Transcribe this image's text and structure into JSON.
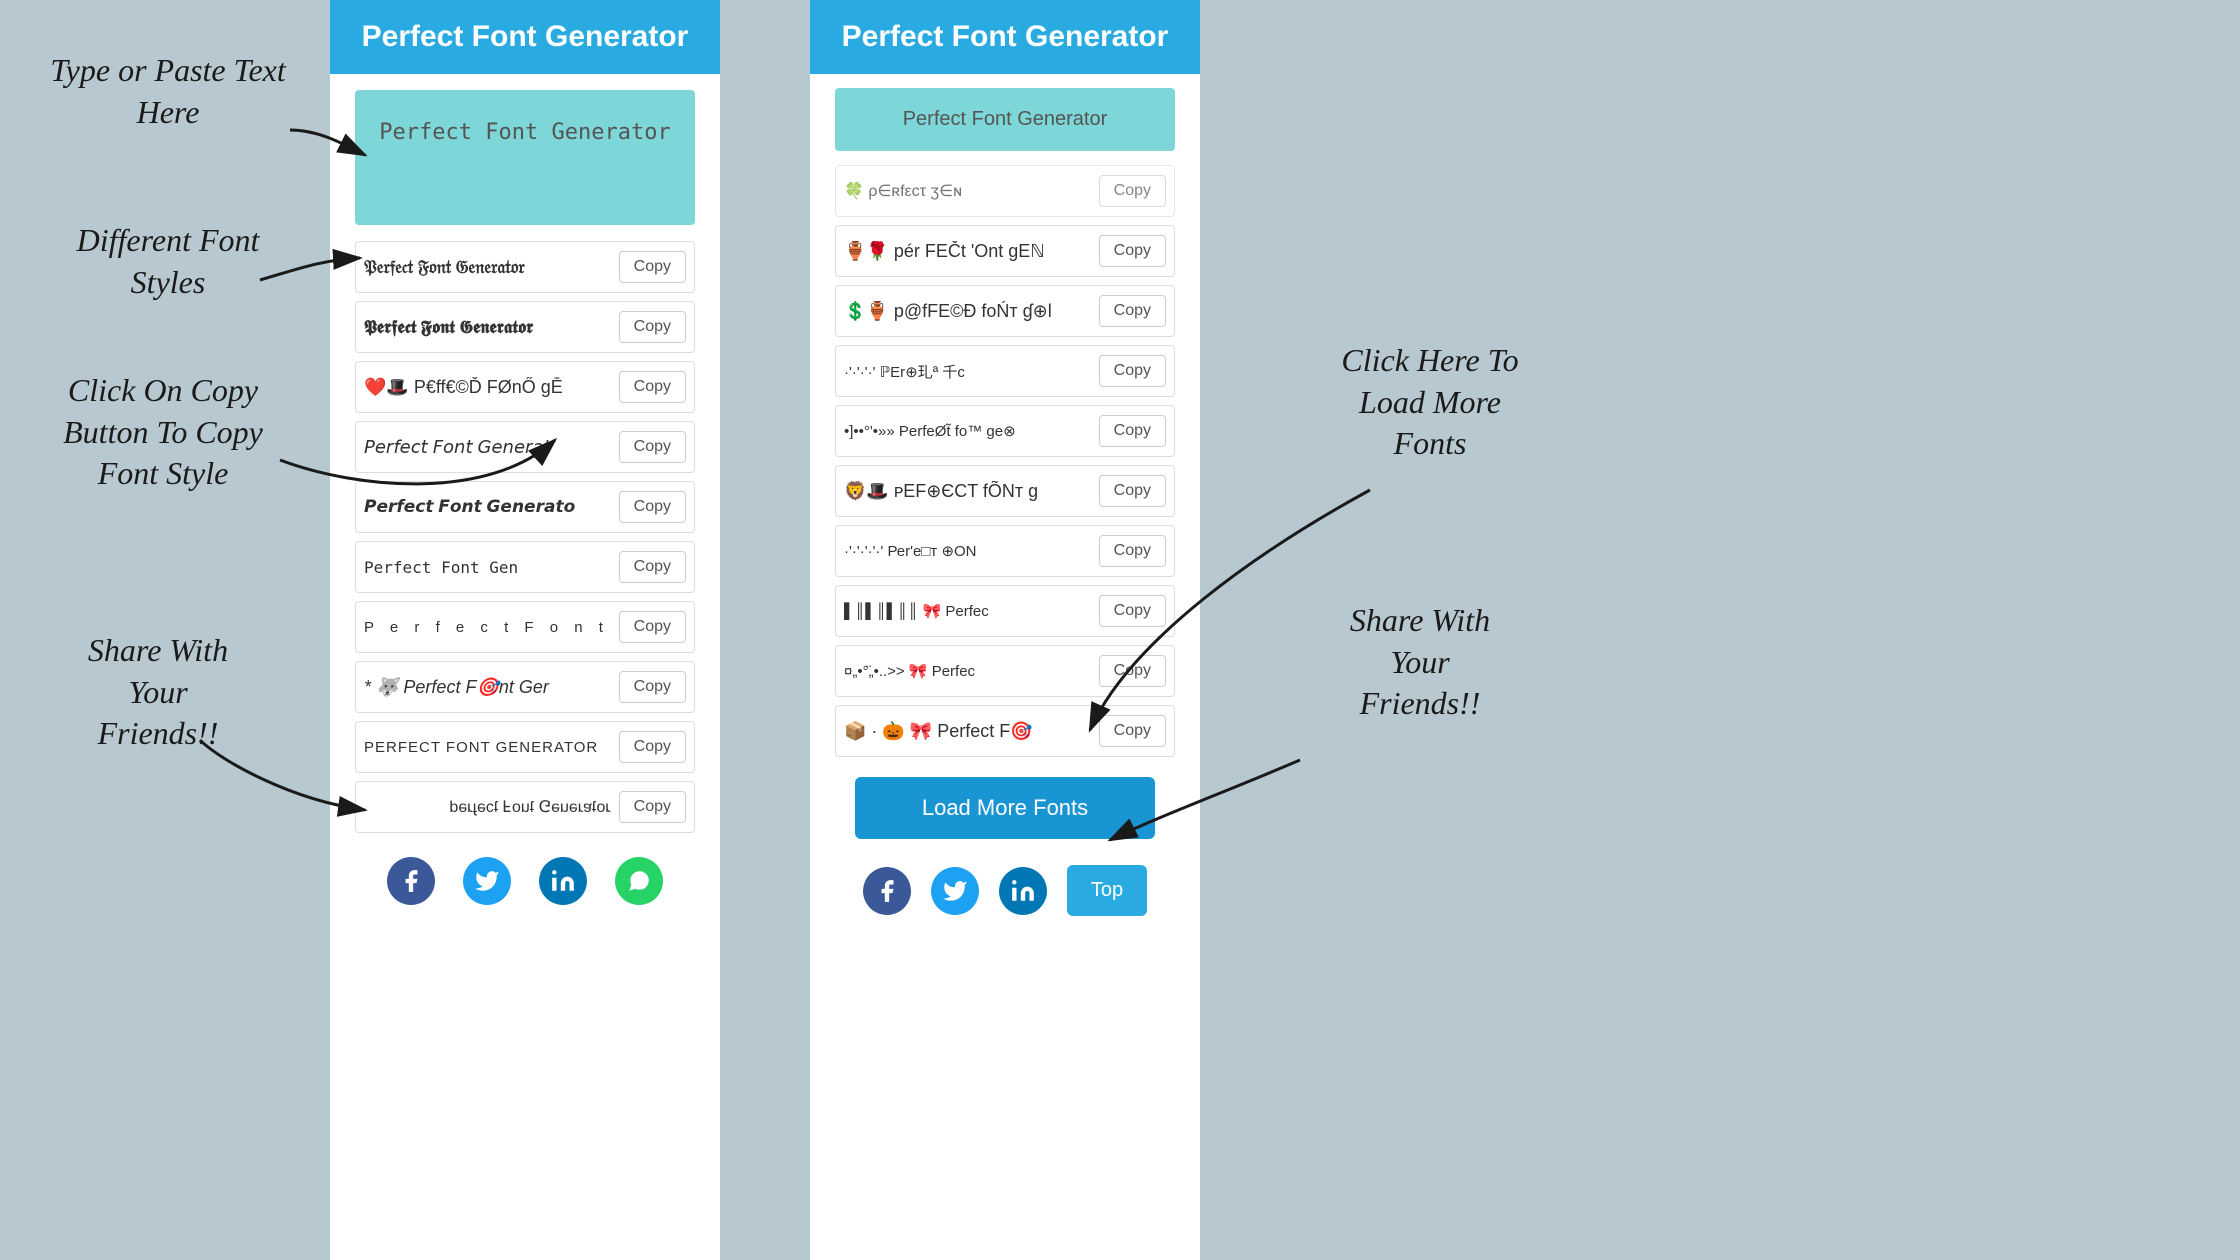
{
  "app": {
    "title": "Perfect Font Generator",
    "input_placeholder": "Perfect Font Generator"
  },
  "annotations": {
    "type_paste": "Type or Paste Text\nHere",
    "different_styles": "Different Font\nStyles",
    "click_copy": "Click On Copy\nButton To Copy\nFont Style",
    "share_friends_left": "Share With\nYour\nFriends!!",
    "click_load_more": "Click Here To\nLoad More\nFonts",
    "share_friends_right": "Share With\nYour\nFriends!!"
  },
  "left_panel": {
    "header": "Perfect Font Generator",
    "input_value": "Perfect Font Generator",
    "font_rows": [
      {
        "text": "𝔓𝔢𝔯𝔣𝔢𝔠𝔱 𝔉𝔬𝔫𝔱 𝔊𝔢𝔫𝔢𝔯𝔞𝔱𝔬𝔯",
        "copy": "Copy",
        "style": "fraktur"
      },
      {
        "text": "𝕻𝖊𝖗𝖋𝖊𝖈𝖙 𝕱𝖔𝖓𝖙 𝕲𝖊𝖓𝖊𝖗𝖆𝖙𝖔𝖗",
        "copy": "Copy",
        "style": "blackletter"
      },
      {
        "text": "❤️🎩 P€ff€©Ď FØnŐ gĒ",
        "copy": "Copy",
        "style": "emoji"
      },
      {
        "text": "𝘗𝘦𝘳𝘧𝘦𝘤𝘵 𝘍𝘰𝘯𝘵 𝘎𝘦𝘯𝘦𝘳𝘢𝘵",
        "copy": "Copy",
        "style": "italic"
      },
      {
        "text": "𝙋𝙚𝙧𝙛𝙚𝙘𝙩 𝙁𝙤𝙣𝙩 𝙂𝙚𝙣𝙚𝙧𝙖𝙩𝙤",
        "copy": "Copy",
        "style": "bold-italic"
      },
      {
        "text": "𝙿𝚎𝚛𝚏𝚎𝚌𝚝 𝙵𝚘𝚗𝚝 𝙶𝚎𝚗𝚎𝚛𝚊𝚝𝚘𝚛",
        "copy": "Copy",
        "style": "mono"
      },
      {
        "text": "P  e  r  f  e  c  t    F  o  n  t",
        "copy": "Copy",
        "style": "wide"
      },
      {
        "text": "* 🐺 Perfect F🎯nt Ger",
        "copy": "Copy",
        "style": "emoji2"
      },
      {
        "text": "PERFECT FONT GENERATOR",
        "copy": "Copy",
        "style": "upper"
      },
      {
        "text": "ɹoʇɐɹǝuǝ⅁ ʇuoℲ ʇɔǝɟɹǝd",
        "copy": "Copy",
        "style": "flip"
      }
    ],
    "share": {
      "facebook": "f",
      "twitter": "t",
      "linkedin": "in",
      "whatsapp": "w"
    }
  },
  "right_panel": {
    "header": "Perfect Font Generator",
    "input_value": "Perfect Font Generator",
    "font_rows": [
      {
        "text": "🍀 ρ∈ʀfεcτ ʒ∈ɴ",
        "copy": "Copy",
        "style": "partial",
        "partial": true
      },
      {
        "text": "🏺🌹 pér FEČt 'Ont gEℕ",
        "copy": "Copy",
        "style": "mixed"
      },
      {
        "text": "💲🏺 p@fFE©Ð foŃт ɠ⊕l",
        "copy": "Copy",
        "style": "symbols"
      },
      {
        "text": "·'·'·'·'  ℙЕr⊕玌ª 千c",
        "copy": "Copy",
        "style": "dots"
      },
      {
        "text": "•]••°'•»» PеrfeØt̃ fo™ ge⊗",
        "copy": "Copy",
        "style": "bullets"
      },
      {
        "text": "🦁🎩 ᴘЕF⊕ЄCT fÕNт g",
        "copy": "Copy",
        "style": "emoji3"
      },
      {
        "text": "·'·'·'·'·' Реr'е□т ⊕ON",
        "copy": "Copy",
        "style": "dots2"
      },
      {
        "text": "▌║▌║▌║║ 🎀 Perfec",
        "copy": "Copy",
        "style": "bars"
      },
      {
        "text": "¤„•°̈„•..>>  🎀 Perfec",
        "copy": "Copy",
        "style": "ornate"
      },
      {
        "text": "📦 · 🎃 🎀 Perfect F🎯",
        "copy": "Copy",
        "style": "emoji4"
      }
    ],
    "load_more": "Load More Fonts",
    "top_btn": "Top",
    "share": {
      "facebook": "f",
      "twitter": "t",
      "linkedin": "in"
    }
  },
  "colors": {
    "header_bg": "#29abe2",
    "input_bg": "#7dd6d8",
    "load_more_bg": "#1a95d4",
    "top_btn_bg": "#29abe2",
    "facebook": "#3b5998",
    "twitter": "#1da1f2",
    "linkedin": "#0077b5",
    "whatsapp": "#25d366"
  }
}
